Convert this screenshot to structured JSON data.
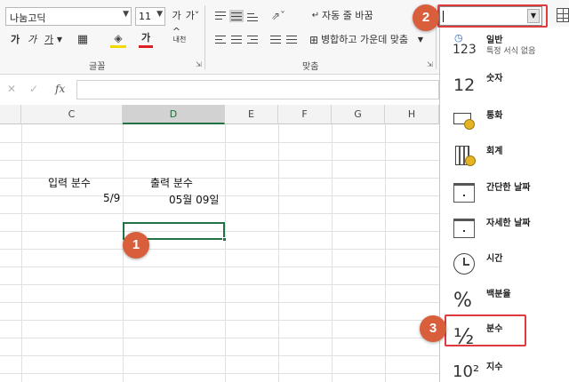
{
  "ribbon": {
    "font_name": "나눔고딕",
    "font_size": "11",
    "grow_font": "가^",
    "shrink_font": "가˅",
    "bold": "가",
    "italic": "가",
    "underline": "가",
    "font_color_glyph": "가",
    "phonetic": "내천",
    "wrap_text": "자동 줄 바꿈",
    "merge_center": "병합하고 가운데 맞춤",
    "font_group_label": "글꼴",
    "align_group_label": "맞춤",
    "number_format_value": ""
  },
  "formula_bar": {
    "cancel": "✕",
    "enter": "✓",
    "fx": "fx",
    "content": ""
  },
  "grid": {
    "columns": [
      "C",
      "D",
      "E",
      "F",
      "G",
      "H"
    ],
    "selected_column": "D",
    "cells": {
      "c3": "입력 분수",
      "d3": "출력 분수",
      "c4": "5/9",
      "d4": "05월 09일"
    }
  },
  "number_formats": [
    {
      "icon": "clock-123-icon",
      "glyph": "123",
      "label": "일반",
      "sub": "특정 서식 없음"
    },
    {
      "icon": "number-icon",
      "glyph": "12",
      "label": "숫자",
      "sub": ""
    },
    {
      "icon": "currency-icon",
      "glyph": "",
      "label": "통화",
      "sub": ""
    },
    {
      "icon": "calculator-icon",
      "glyph": "",
      "label": "회계",
      "sub": ""
    },
    {
      "icon": "calendar-short-icon",
      "glyph": "",
      "label": "간단한 날짜",
      "sub": ""
    },
    {
      "icon": "calendar-long-icon",
      "glyph": "",
      "label": "자세한 날짜",
      "sub": ""
    },
    {
      "icon": "clock-icon",
      "glyph": "",
      "label": "시간",
      "sub": ""
    },
    {
      "icon": "percent-icon",
      "glyph": "%",
      "label": "백분율",
      "sub": ""
    },
    {
      "icon": "fraction-icon",
      "glyph": "½",
      "label": "분수",
      "sub": ""
    },
    {
      "icon": "scientific-icon",
      "glyph": "10²",
      "label": "지수",
      "sub": ""
    }
  ],
  "callouts": [
    "1",
    "2",
    "3"
  ],
  "colors": {
    "callout": "#d95e3b",
    "highlight": "#e03a3e",
    "excel_green": "#217346"
  }
}
